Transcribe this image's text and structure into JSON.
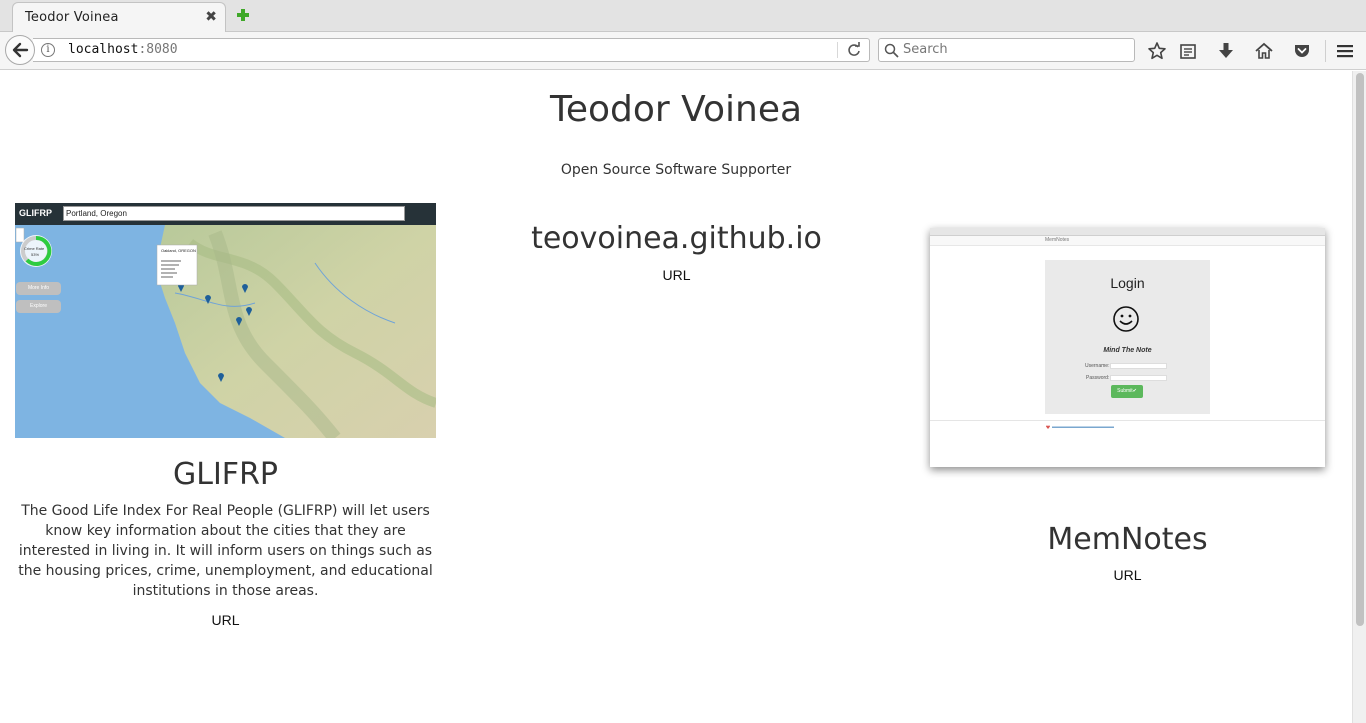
{
  "browser": {
    "tab_title": "Teodor Voinea",
    "tab_close": "✖",
    "url_host": "localhost",
    "url_port": ":8080",
    "search_placeholder": "Search"
  },
  "header": {
    "title": "Teodor Voinea",
    "subtitle": "Open Source Software Supporter"
  },
  "projects": [
    {
      "title": "GLIFRP",
      "description": "The Good Life Index For Real People (GLIFRP) will let users know key information about the cities that they are interested in living in. It will inform users on things such as the housing prices, crime, unemployment, and educational institutions in those areas.",
      "url_label": "URL",
      "screenshot": {
        "brand": "GLIFRP",
        "search_value": "Portland, Oregon",
        "gauge_label": "Crime Rate",
        "gauge_value": "53%",
        "popup_title": "Oakland, OREGON",
        "button_more": "More Info",
        "button_explore": "Explore"
      }
    },
    {
      "title": "teovoinea.github.io",
      "url_label": "URL"
    },
    {
      "title": "MemNotes",
      "url_label": "URL",
      "screenshot": {
        "brand": "MemNotes",
        "login_title": "Login",
        "tagline": "Mind The Note",
        "username_label": "Username:",
        "password_label": "Password:",
        "submit_label": "Submit✔"
      }
    }
  ]
}
